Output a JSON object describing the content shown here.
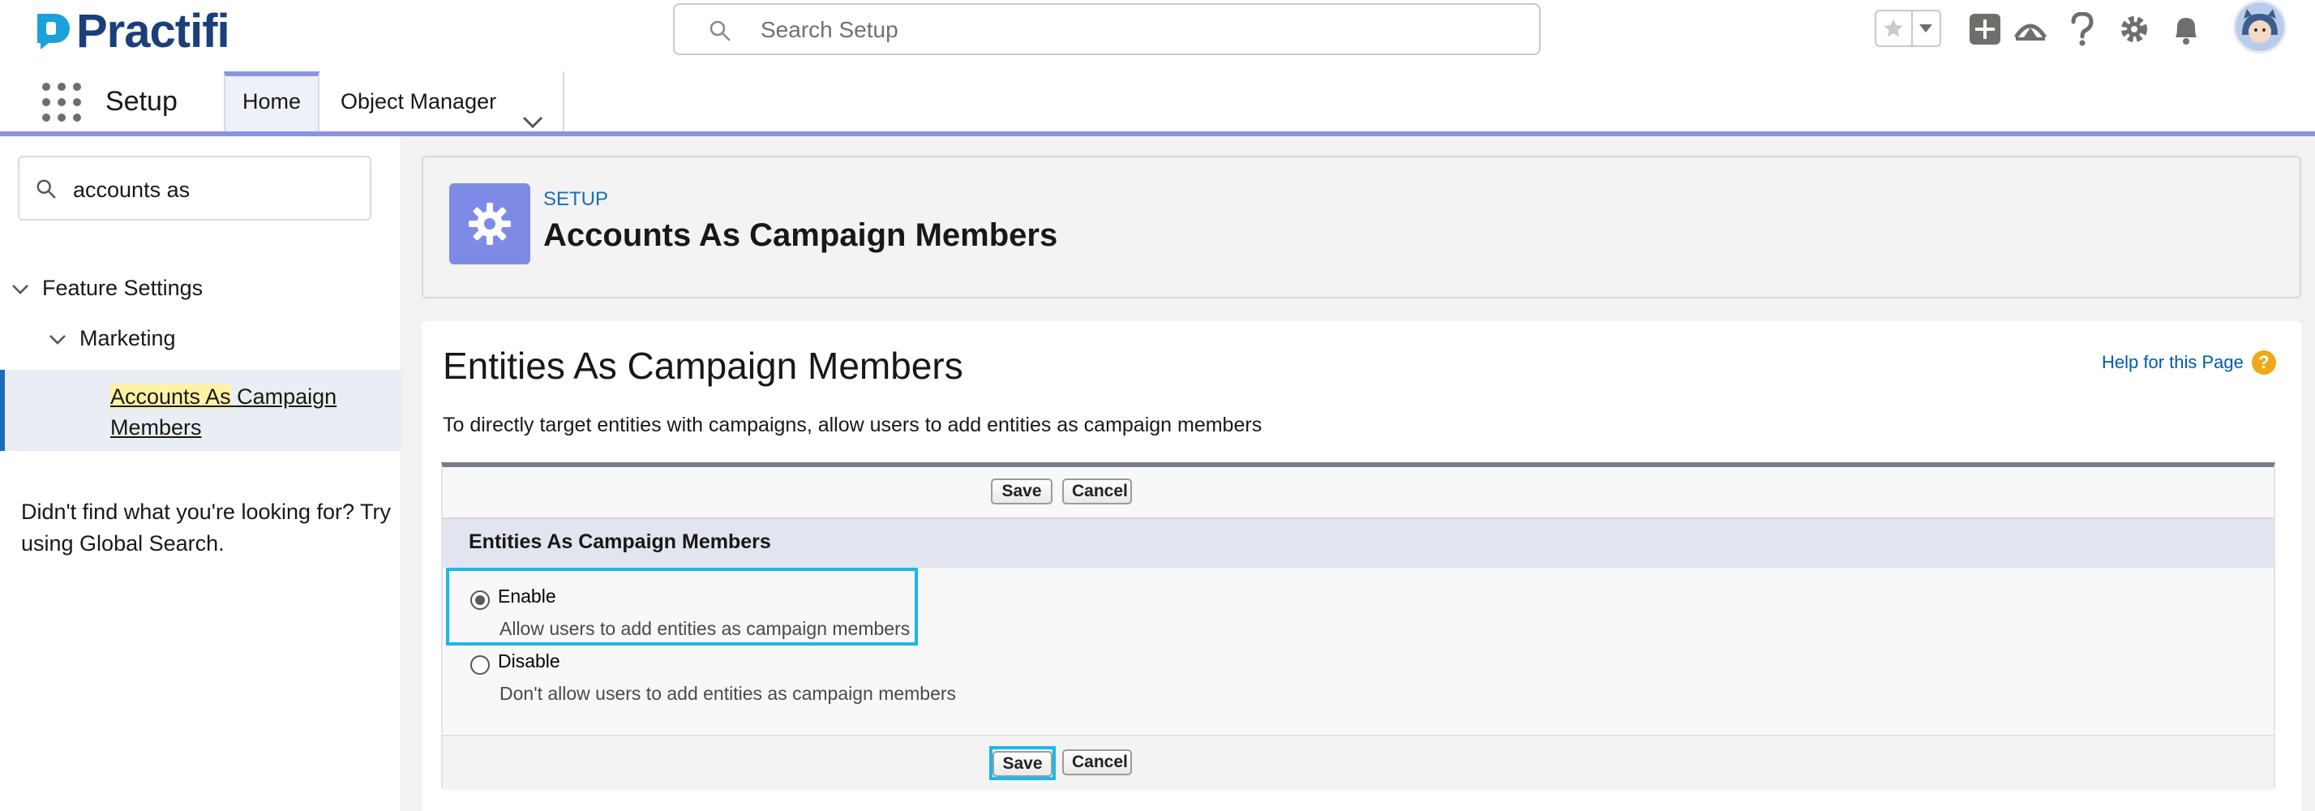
{
  "brand": {
    "name": "Practifi",
    "color": "#1b3f79"
  },
  "header": {
    "search_placeholder": "Search Setup",
    "icons": [
      "favorites-star-icon",
      "favorites-dropdown-icon",
      "add-icon",
      "trailhead-icon",
      "help-icon",
      "setup-gear-icon",
      "notifications-bell-icon",
      "user-avatar"
    ]
  },
  "app_nav": {
    "app_name": "Setup",
    "tabs": [
      {
        "label": "Home",
        "active": true
      },
      {
        "label": "Object Manager",
        "active": false
      }
    ],
    "accent_color": "#8b93e4"
  },
  "sidebar": {
    "quick_find_value": "accounts as",
    "tree": {
      "level1": "Feature Settings",
      "level2": "Marketing",
      "level3_highlight": "Accounts As",
      "level3_rest": " Campaign Members"
    },
    "not_found": "Didn't find what you're looking for? Try using Global Search."
  },
  "page_header": {
    "eyebrow": "SETUP",
    "title": "Accounts As Campaign Members",
    "icon": "gear-icon",
    "icon_color": "#7d8ae6"
  },
  "content": {
    "title": "Entities As Campaign Members",
    "help_link": "Help for this Page",
    "description": "To directly target entities with campaigns, allow users to add entities as campaign members",
    "buttons": {
      "save": "Save",
      "cancel": "Cancel"
    },
    "section_title": "Entities As Campaign Members",
    "options": [
      {
        "label": "Enable",
        "hint": "Allow users to add entities as campaign members",
        "selected": true
      },
      {
        "label": "Disable",
        "hint": "Don't allow users to add entities as campaign members",
        "selected": false
      }
    ],
    "highlight_color": "#1ab9e8"
  }
}
